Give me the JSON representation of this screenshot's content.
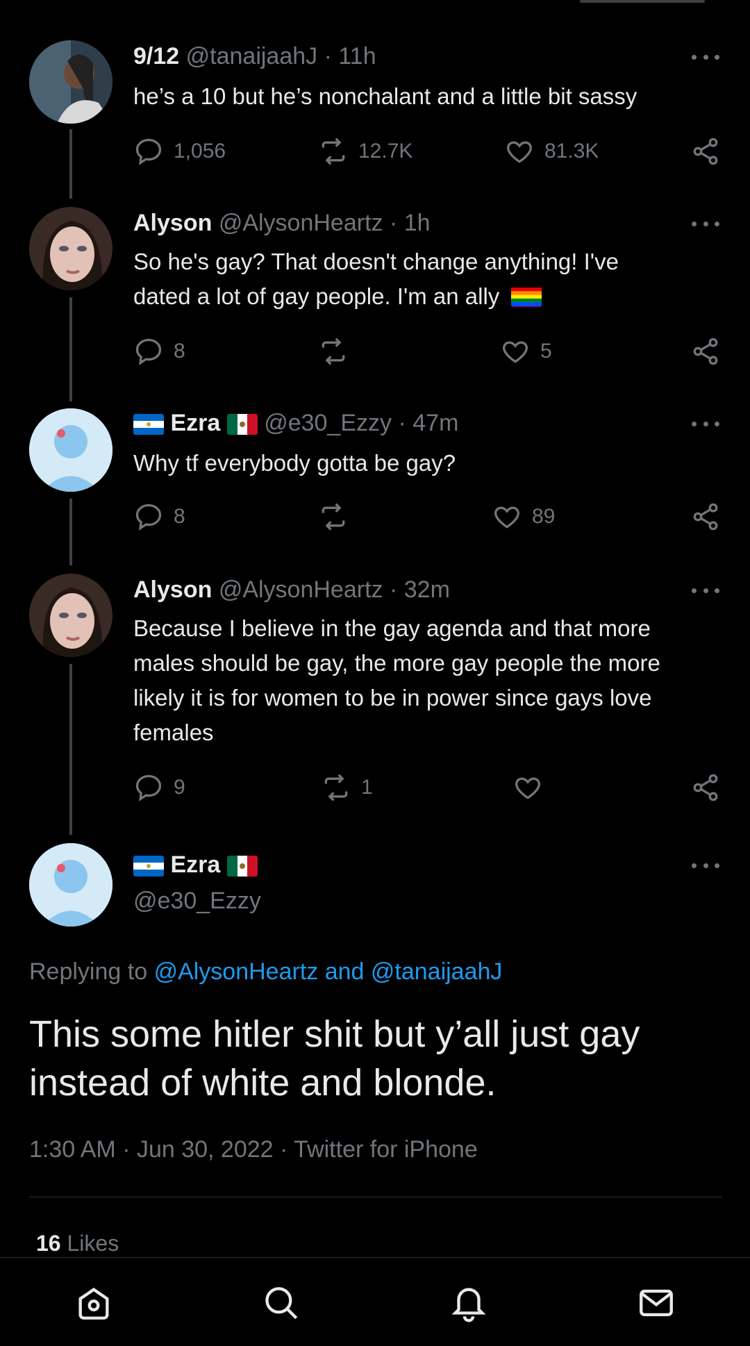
{
  "tweets": [
    {
      "display_name": "9/12",
      "handle": "@tanaijaahJ",
      "time": "· 11h",
      "text": "he’s a 10 but he’s nonchalant and a little bit sassy",
      "replies": "1,056",
      "retweets": "12.7K",
      "likes": "81.3K"
    },
    {
      "display_name": "Alyson",
      "handle": "@AlysonHeartz",
      "time": "· 1h",
      "text_line1": "So he's gay? That doesn't change anything! I've",
      "text_line2": "dated a lot of gay people. I'm an ally",
      "replies": "8",
      "retweets": "",
      "likes": "5"
    },
    {
      "display_name": "Ezra",
      "handle": "@e30_Ezzy",
      "time": "· 47m",
      "text": "Why tf everybody gotta be gay?",
      "replies": "8",
      "retweets": "",
      "likes": "89"
    },
    {
      "display_name": "Alyson",
      "handle": "@AlysonHeartz",
      "time": "· 32m",
      "text": "Because I believe in the gay agenda and that more males should be gay, the more gay people the more likely it is for women to be in power since gays love females",
      "replies": "9",
      "retweets": "1",
      "likes": ""
    }
  ],
  "main_tweet": {
    "display_name": "Ezra",
    "handle": "@e30_Ezzy",
    "replying_prefix": "Replying to",
    "replying_users": "@AlysonHeartz and @tanaijaahJ",
    "text": "This some hitler shit but y’all just gay instead of white and blonde.",
    "meta": "1:30 AM · Jun 30, 2022 · Twitter for iPhone",
    "likes_count": "16",
    "likes_label": "Likes"
  },
  "bottom_nav": [
    "home-icon",
    "search-icon",
    "notifications-icon",
    "messages-icon"
  ],
  "colors": {
    "background": "#000000",
    "text": "#e7e9ea",
    "muted": "#71767b",
    "link": "#1d9bf0"
  }
}
